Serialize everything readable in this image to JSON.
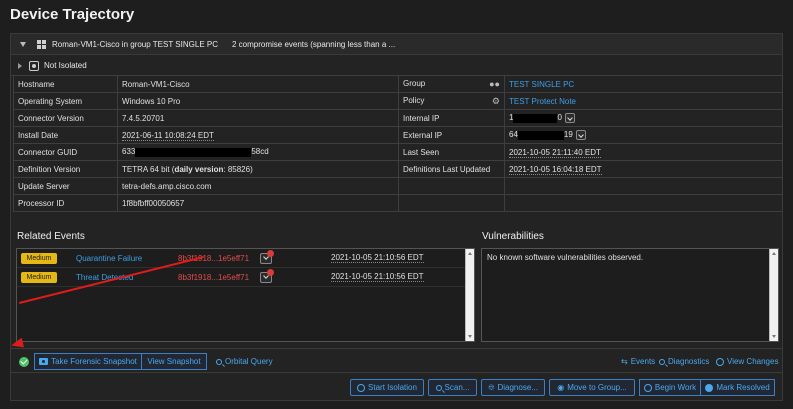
{
  "page": {
    "title": "Device Trajectory"
  },
  "header": {
    "title": "Roman-VM1-Cisco in group TEST SINGLE PC",
    "events_summary": "2 compromise events (spanning less than a ..."
  },
  "isolation": {
    "status": "Not Isolated"
  },
  "info": {
    "hostname": {
      "label": "Hostname",
      "value": "Roman-VM1-Cisco"
    },
    "os": {
      "label": "Operating System",
      "value": "Windows 10 Pro"
    },
    "connector_version": {
      "label": "Connector Version",
      "value": "7.4.5.20701"
    },
    "install_date": {
      "label": "Install Date",
      "value": "2021-06-11 10:08:24 EDT"
    },
    "connector_guid": {
      "label": "Connector GUID",
      "prefix": "633",
      "suffix": "58cd"
    },
    "definition_version": {
      "label": "Definition Version",
      "value": "TETRA 64 bit (",
      "bold": "daily version",
      "value_end": ": 85826)"
    },
    "update_server": {
      "label": "Update Server",
      "value": "tetra-defs.amp.cisco.com"
    },
    "processor_id": {
      "label": "Processor ID",
      "value": "1f8bfbff00050657"
    },
    "group": {
      "label": "Group",
      "value": "TEST SINGLE PC"
    },
    "policy": {
      "label": "Policy",
      "value": "TEST Protect Note"
    },
    "internal_ip": {
      "label": "Internal IP",
      "prefix": "1",
      "suffix": "0"
    },
    "external_ip": {
      "label": "External IP",
      "prefix": "64",
      "suffix": "19"
    },
    "last_seen": {
      "label": "Last Seen",
      "value": "2021-10-05 21:11:40 EDT"
    },
    "definitions_updated": {
      "label": "Definitions Last Updated",
      "value": "2021-10-05 16:04:18 EDT"
    }
  },
  "related_events": {
    "title": "Related Events",
    "rows": [
      {
        "severity": "Medium",
        "name": "Quarantine Failure",
        "hash": "8b3f1918...1e5eff71",
        "time": "2021-10-05 21:10:56 EDT"
      },
      {
        "severity": "Medium",
        "name": "Threat Detected",
        "hash": "8b3f1918...1e5eff71",
        "time": "2021-10-05 21:10:56 EDT"
      }
    ]
  },
  "vulnerabilities": {
    "title": "Vulnerabilities",
    "text": "No known software vulnerabilities observed."
  },
  "actions": {
    "forensic_snapshot": "Take Forensic Snapshot",
    "view_snapshot": "View Snapshot",
    "orbital_query": "Orbital Query",
    "events": "Events",
    "diagnostics": "Diagnostics",
    "view_changes": "View Changes"
  },
  "bottom_actions": {
    "start_isolation": "Start Isolation",
    "scan": "Scan...",
    "diagnose": "Diagnose...",
    "move_to_group": "Move to Group...",
    "begin_work": "Begin Work",
    "mark_resolved": "Mark Resolved"
  },
  "colors": {
    "accent": "#3b9fe6",
    "hash_red": "#e24b4b",
    "badge_medium": "#e6b814",
    "annotation_arrow": "#e11b1b"
  }
}
